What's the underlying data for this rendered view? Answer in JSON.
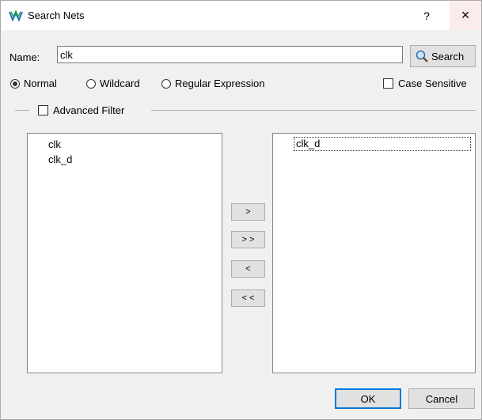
{
  "window": {
    "title": "Search Nets",
    "help": "?",
    "close": "×"
  },
  "name": {
    "label": "Name:",
    "value": "clk",
    "search_label": "Search"
  },
  "options": {
    "normal": "Normal",
    "wildcard": "Wildcard",
    "regex": "Regular Expression",
    "case_sensitive": "Case Sensitive",
    "selected": "Normal"
  },
  "advanced_filter": {
    "label": "Advanced Filter"
  },
  "left_list": {
    "items": [
      "clk",
      "clk_d"
    ]
  },
  "right_list": {
    "items": [
      "clk_d"
    ]
  },
  "transfer": {
    "add": ">",
    "add_all": "> >",
    "remove": "<",
    "remove_all": "< <"
  },
  "buttons": {
    "ok": "OK",
    "cancel": "Cancel"
  },
  "colors": {
    "accent": "#0078d7",
    "title_bar": "#ffffff",
    "close_hover": "#fbecec",
    "icon_green": "#2e9e44",
    "icon_blue": "#1f74c6"
  }
}
